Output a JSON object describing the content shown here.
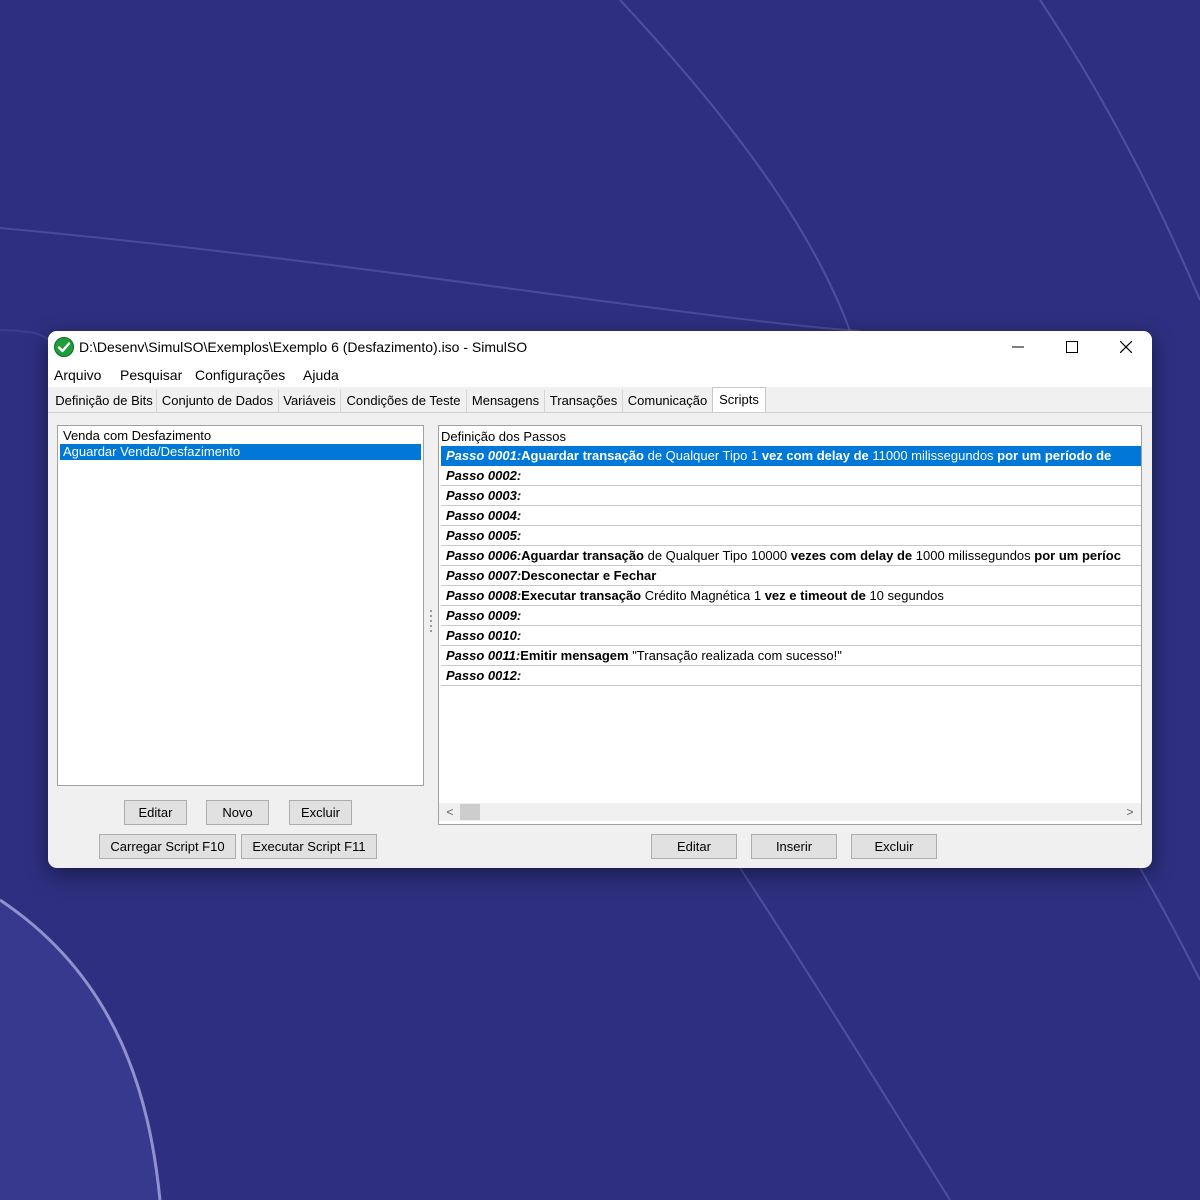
{
  "window": {
    "title": "D:\\Desenv\\SimulSO\\Exemplos\\Exemplo 6 (Desfazimento).iso - SimulSO",
    "controls": {
      "minimize": "—",
      "maximize": "☐",
      "close": "✕"
    }
  },
  "menu": [
    "Arquivo",
    "Pesquisar",
    "Configurações",
    "Ajuda"
  ],
  "tabs": [
    "Definição de Bits",
    "Conjunto de Dados",
    "Variáveis",
    "Condições de Teste",
    "Mensagens",
    "Transações",
    "Comunicação",
    "Scripts"
  ],
  "active_tab": "Scripts",
  "scripts": {
    "items": [
      "Venda com Desfazimento",
      "Aguardar Venda/Desfazimento"
    ],
    "selected": "Aguardar Venda/Desfazimento",
    "buttons": {
      "edit": "Editar",
      "new": "Novo",
      "delete": "Excluir",
      "load": "Carregar Script F10",
      "run": "Executar Script F11"
    }
  },
  "steps": {
    "header": "Definição dos Passos",
    "rows": [
      {
        "num": "Passo 0001:",
        "segments": [
          {
            "t": "Aguardar transação",
            "b": true
          },
          {
            "t": " de Qualquer Tipo 1 ",
            "b": false
          },
          {
            "t": "vez com delay de",
            "b": true
          },
          {
            "t": " 11000 milissegundos ",
            "b": false
          },
          {
            "t": "por um período de",
            "b": true
          }
        ]
      },
      {
        "num": "Passo 0002:",
        "segments": []
      },
      {
        "num": "Passo 0003:",
        "segments": []
      },
      {
        "num": "Passo 0004:",
        "segments": []
      },
      {
        "num": "Passo 0005:",
        "segments": []
      },
      {
        "num": "Passo 0006:",
        "segments": [
          {
            "t": "Aguardar transação",
            "b": true
          },
          {
            "t": " de Qualquer Tipo 10000 ",
            "b": false
          },
          {
            "t": "vezes com delay de",
            "b": true
          },
          {
            "t": " 1000 milissegundos ",
            "b": false
          },
          {
            "t": "por um períoc",
            "b": true
          }
        ]
      },
      {
        "num": "Passo 0007:",
        "segments": [
          {
            "t": "Desconectar e Fechar",
            "b": true
          }
        ]
      },
      {
        "num": "Passo 0008:",
        "segments": [
          {
            "t": "Executar transação",
            "b": true
          },
          {
            "t": " Crédito Magnética 1 ",
            "b": false
          },
          {
            "t": "vez e timeout de",
            "b": true
          },
          {
            "t": " 10 segundos",
            "b": false
          }
        ]
      },
      {
        "num": "Passo 0009:",
        "segments": []
      },
      {
        "num": "Passo 0010:",
        "segments": []
      },
      {
        "num": "Passo 0011:",
        "segments": [
          {
            "t": "Emitir mensagem",
            "b": true
          },
          {
            "t": " \"Transação realizada com sucesso!\"",
            "b": false
          }
        ]
      },
      {
        "num": "Passo 0012:",
        "segments": []
      }
    ],
    "selected_index": 0,
    "scroll": {
      "left_arrow": "<",
      "right_arrow": ">"
    },
    "buttons": {
      "edit": "Editar",
      "insert": "Inserir",
      "delete": "Excluir"
    }
  },
  "colors": {
    "selection": "#0078d7",
    "desktop": "#2e2f80",
    "window_bg": "#f0f0f0",
    "app_icon": "#1f9e3b"
  }
}
